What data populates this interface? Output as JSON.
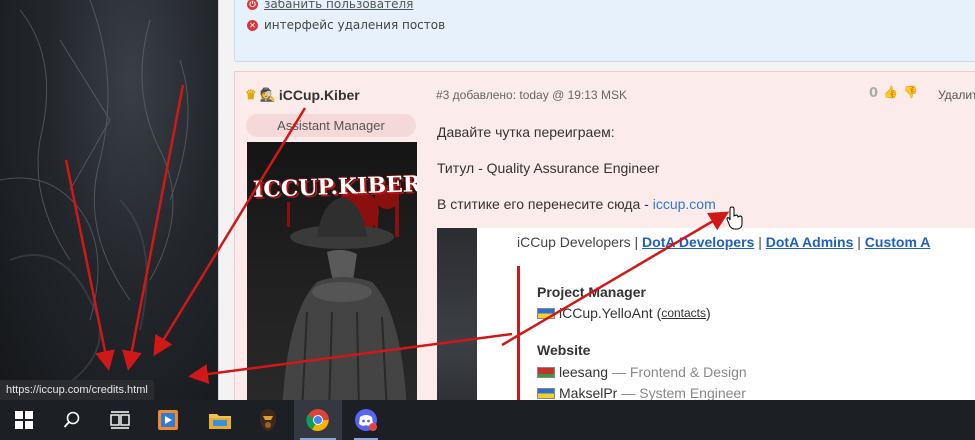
{
  "notice": {
    "items": [
      {
        "text": "забанить пользователя",
        "icon": "power-icon"
      },
      {
        "text": "интерфейс удаления постов",
        "icon": "cross-icon"
      }
    ]
  },
  "post": {
    "author": "iCCup.Kiber",
    "role": "Assistant Manager",
    "avatar_text": "ICCUP.KIBER",
    "meta": "#3 добавлено: today @ 19:13 MSK",
    "votes": "0",
    "delete_label": "Удалит",
    "lines": {
      "line1": "Давайте чутка переиграем:",
      "line2": "Титул - Quality Assurance Engineer",
      "line3_prefix": "В ститике его перенесите сюда - ",
      "line3_link": "iccup.com"
    },
    "embed": {
      "nav_plain": "iCCup Developers",
      "nav_sep": " | ",
      "nav_links": [
        "DotA Developers",
        "DotA Admins",
        "Custom A"
      ],
      "section1_title": "Project Manager",
      "pm_name": "iCCup.YelloAnt",
      "pm_contacts": "contacts",
      "section2_title": "Website",
      "web1_name": "leesang",
      "web1_role": "— Frontend & Design",
      "web2_name": "MakselPr",
      "web2_role": "— System Engineer"
    }
  },
  "status_url": "https://iccup.com/credits.html",
  "taskbar": {
    "items": [
      "start-windows-icon",
      "search-icon",
      "task-view-icon",
      "media-player-icon",
      "file-explorer-icon",
      "game-helmet-icon",
      "chrome-icon",
      "discord-icon"
    ]
  },
  "colors": {
    "annotation_arrow": "#d01818",
    "link": "#2a7ac7",
    "post_bg": "#fcebeb"
  }
}
